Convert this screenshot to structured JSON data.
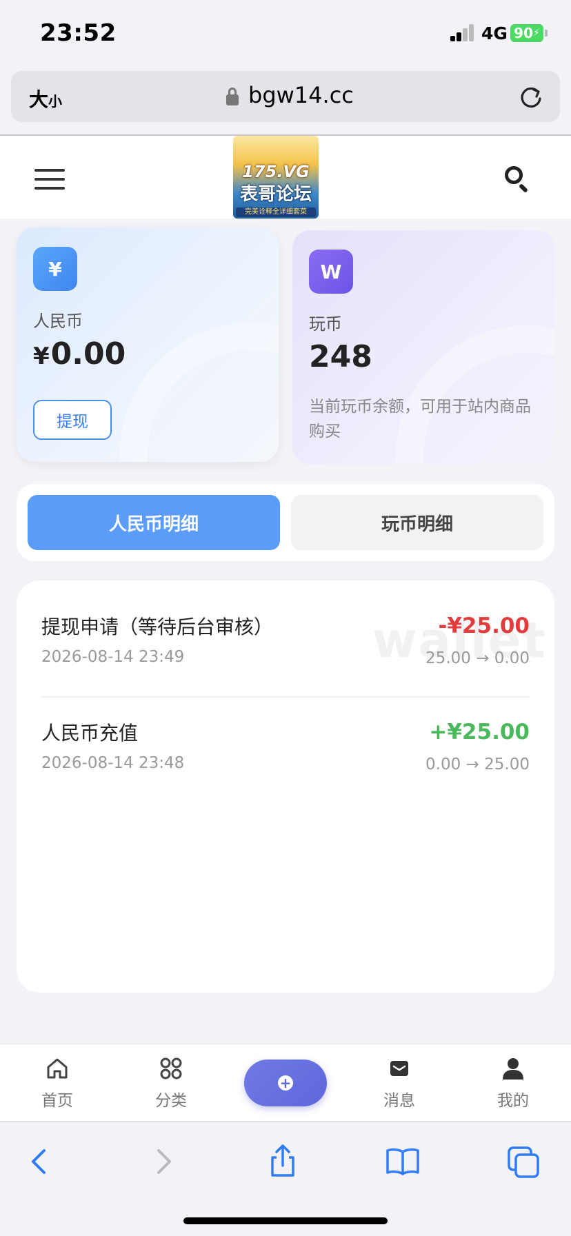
{
  "status_bar": {
    "time": "23:52",
    "network": "4G",
    "battery": "90"
  },
  "browser": {
    "text_size_label_big": "大",
    "text_size_label_small": "小",
    "domain": "bgw14.cc"
  },
  "site_header": {
    "logo": {
      "line1": "175.VG",
      "line2": "表哥论坛",
      "line3": "完美诠释全详细套菜"
    }
  },
  "rmb_card": {
    "icon_glyph": "¥",
    "label": "人民币",
    "currency": "¥",
    "amount": "0.00",
    "withdraw_label": "提现"
  },
  "coin_card": {
    "icon_glyph": "W",
    "label": "玩币",
    "amount": "248",
    "description": "当前玩币余额，可用于站内商品购买"
  },
  "tabs": [
    {
      "label": "人民币明细",
      "active": true
    },
    {
      "label": "玩币明细",
      "active": false
    }
  ],
  "transactions": {
    "watermark": "wallet",
    "items": [
      {
        "title": "提现申请（等待后台审核）",
        "date": "2026-08-14 23:49",
        "amount": "-¥25.00",
        "balance": "25.00 → 0.00",
        "type": "debit"
      },
      {
        "title": "人民币充值",
        "date": "2026-08-14 23:48",
        "amount": "+¥25.00",
        "balance": "0.00 → 25.00",
        "type": "credit"
      }
    ]
  },
  "bottom_nav": [
    {
      "label": "首页",
      "icon": "home-icon"
    },
    {
      "label": "分类",
      "icon": "grid-icon"
    },
    {
      "label": "",
      "icon": "plus-circle-icon"
    },
    {
      "label": "消息",
      "icon": "mail-icon"
    },
    {
      "label": "我的",
      "icon": "user-icon"
    }
  ],
  "colors": {
    "primary": "#5a9cf8",
    "debit": "#e23d3d",
    "credit": "#4cb85c",
    "fab": "#6470df",
    "coin_icon": "#7a5fee"
  }
}
